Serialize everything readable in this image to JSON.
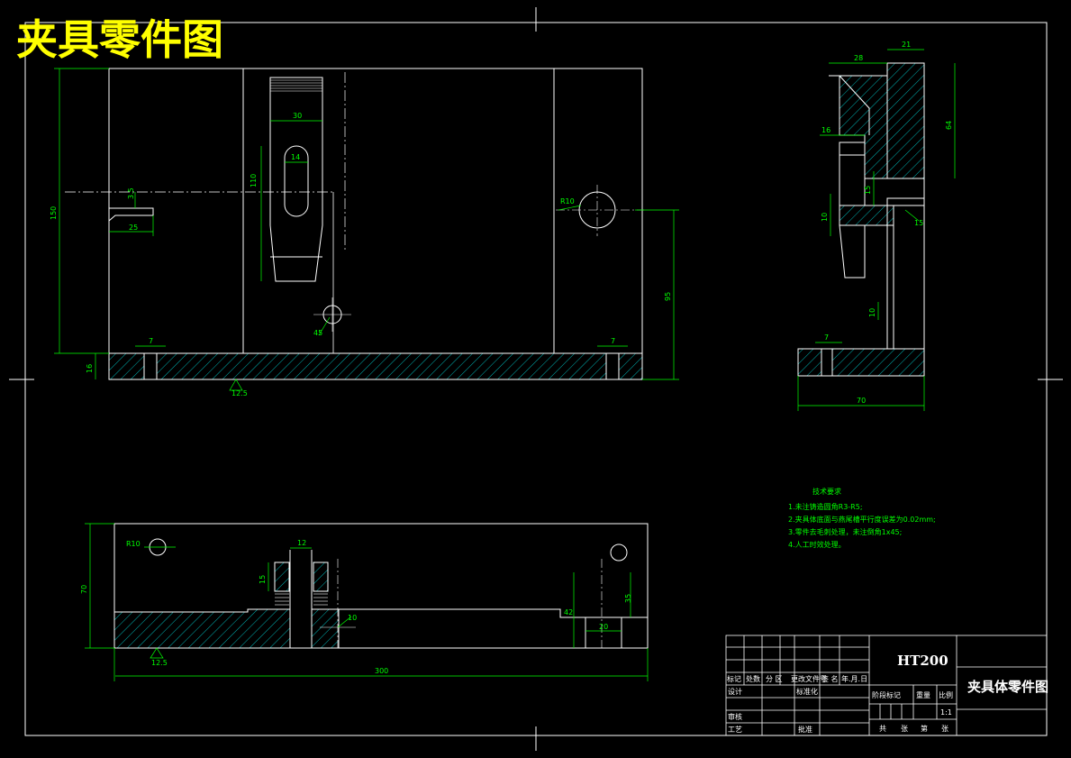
{
  "drawing": {
    "big_title": "夹具零件图",
    "material": "HT200",
    "part_name": "夹具体零件图",
    "scale": "1:1"
  },
  "tech_requirements": {
    "heading": "技术要求",
    "items": [
      "1.未注铸造圆角R3-R5;",
      "2.夹具体底面与燕尾槽平行度误差为0.02mm;",
      "3.零件去毛刺处理，未注倒角1x45;",
      "4.人工时效处理。"
    ]
  },
  "front_view_dims": {
    "slot_width": "30",
    "slot_inner": "14",
    "slot_height": "110",
    "overall_height": "150",
    "notch_depth": "3.5",
    "notch_width": "25",
    "hole_radius": "R10",
    "right_height": "95",
    "base_thickness": "16",
    "counterbore_left": "7",
    "counterbore_right": "7",
    "angle": "45",
    "roughness": "12.5"
  },
  "side_view_dims": {
    "top_width": "28",
    "top_right": "21",
    "top_height": "64",
    "step": "16",
    "mid": "15",
    "mid2": "10",
    "angle": "15",
    "lower": "10",
    "counterbore": "7",
    "base_width": "70"
  },
  "top_view_dims": {
    "hole_label": "R10",
    "height": "70",
    "post_width": "12",
    "post_height": "15",
    "right_h": "35",
    "right_w": "20",
    "right_step": "42",
    "angle": "10",
    "overall_length": "300",
    "roughness": "12.5"
  },
  "title_block": {
    "col_headers": [
      "标记",
      "处数",
      "分 区",
      "更改文件号",
      "签 名",
      "年.月.日"
    ],
    "row_design": "设计",
    "row_standard": "标准化",
    "row_review": "审核",
    "row_process": "工艺",
    "row_approve": "批准",
    "stage_headers": [
      "阶段标记",
      "重量",
      "比例"
    ],
    "footer": [
      "共",
      "张",
      "第",
      "张"
    ]
  }
}
